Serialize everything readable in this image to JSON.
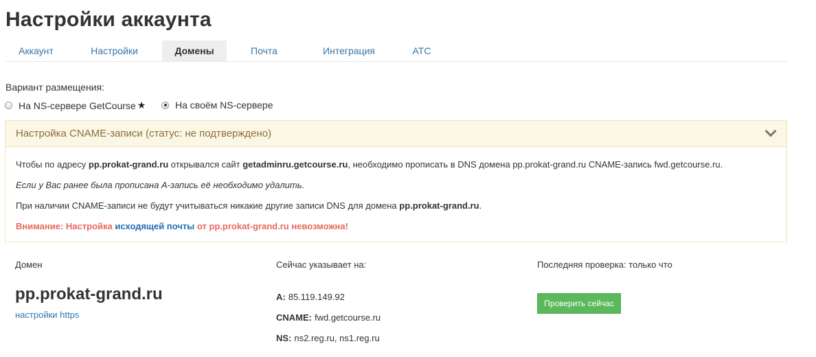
{
  "page": {
    "title": "Настройки аккаунта"
  },
  "tabs": [
    {
      "label": "Аккаунт",
      "active": false
    },
    {
      "label": "Настройки",
      "active": false
    },
    {
      "label": "Домены",
      "active": true
    },
    {
      "label": "Почта",
      "active": false
    },
    {
      "label": "Интеграция",
      "active": false
    },
    {
      "label": "АТС",
      "active": false
    }
  ],
  "placement": {
    "label": "Вариант размещения:",
    "options": [
      {
        "label": "На NS-сервере GetCourse",
        "icon": "star-icon",
        "icon_char": "★",
        "checked": false
      },
      {
        "label": "На своём NS-сервере",
        "checked": true
      }
    ]
  },
  "cname": {
    "header": "Настройка CNAME-записи (статус: не подтверждено)",
    "line1": {
      "t1": "Чтобы по адресу ",
      "domain": "pp.prokat-grand.ru",
      "t2": " открывался сайт ",
      "site": "getadminru.getcourse.ru",
      "t3": ", необходимо прописать в DNS домена pp.prokat-grand.ru CNAME-запись fwd.getcourse.ru."
    },
    "line2": "Если у Вас ранее была прописана А-запись её необходимо удалить.",
    "line3": {
      "t1": "При наличии CNAME-записи не будут учитываться никакие другие записи DNS для домена ",
      "domain": "pp.prokat-grand.ru",
      "t2": "."
    },
    "warning": {
      "t1": "Внимание: Настройка ",
      "link": "исходящей почты",
      "t2": " от pp.prokat-grand.ru невозможна!"
    }
  },
  "domain_table": {
    "col_domain": "Домен",
    "col_points": "Сейчас указывает на:",
    "col_check": "Последняя проверка: только что",
    "domain": "pp.prokat-grand.ru",
    "https_link": "настройки https",
    "records": [
      {
        "type": "A:",
        "value": "85.119.149.92"
      },
      {
        "type": "CNAME:",
        "value": "fwd.getcourse.ru"
      },
      {
        "type": "NS:",
        "value": "ns2.reg.ru, ns1.reg.ru"
      }
    ],
    "check_button": "Проверить сейчас"
  },
  "colors": {
    "link": "#3575a8",
    "panel_header_bg": "#fcf7e5",
    "panel_header_text": "#8a6d3b",
    "warning": "#e8685d",
    "button_green": "#5cb85c"
  }
}
